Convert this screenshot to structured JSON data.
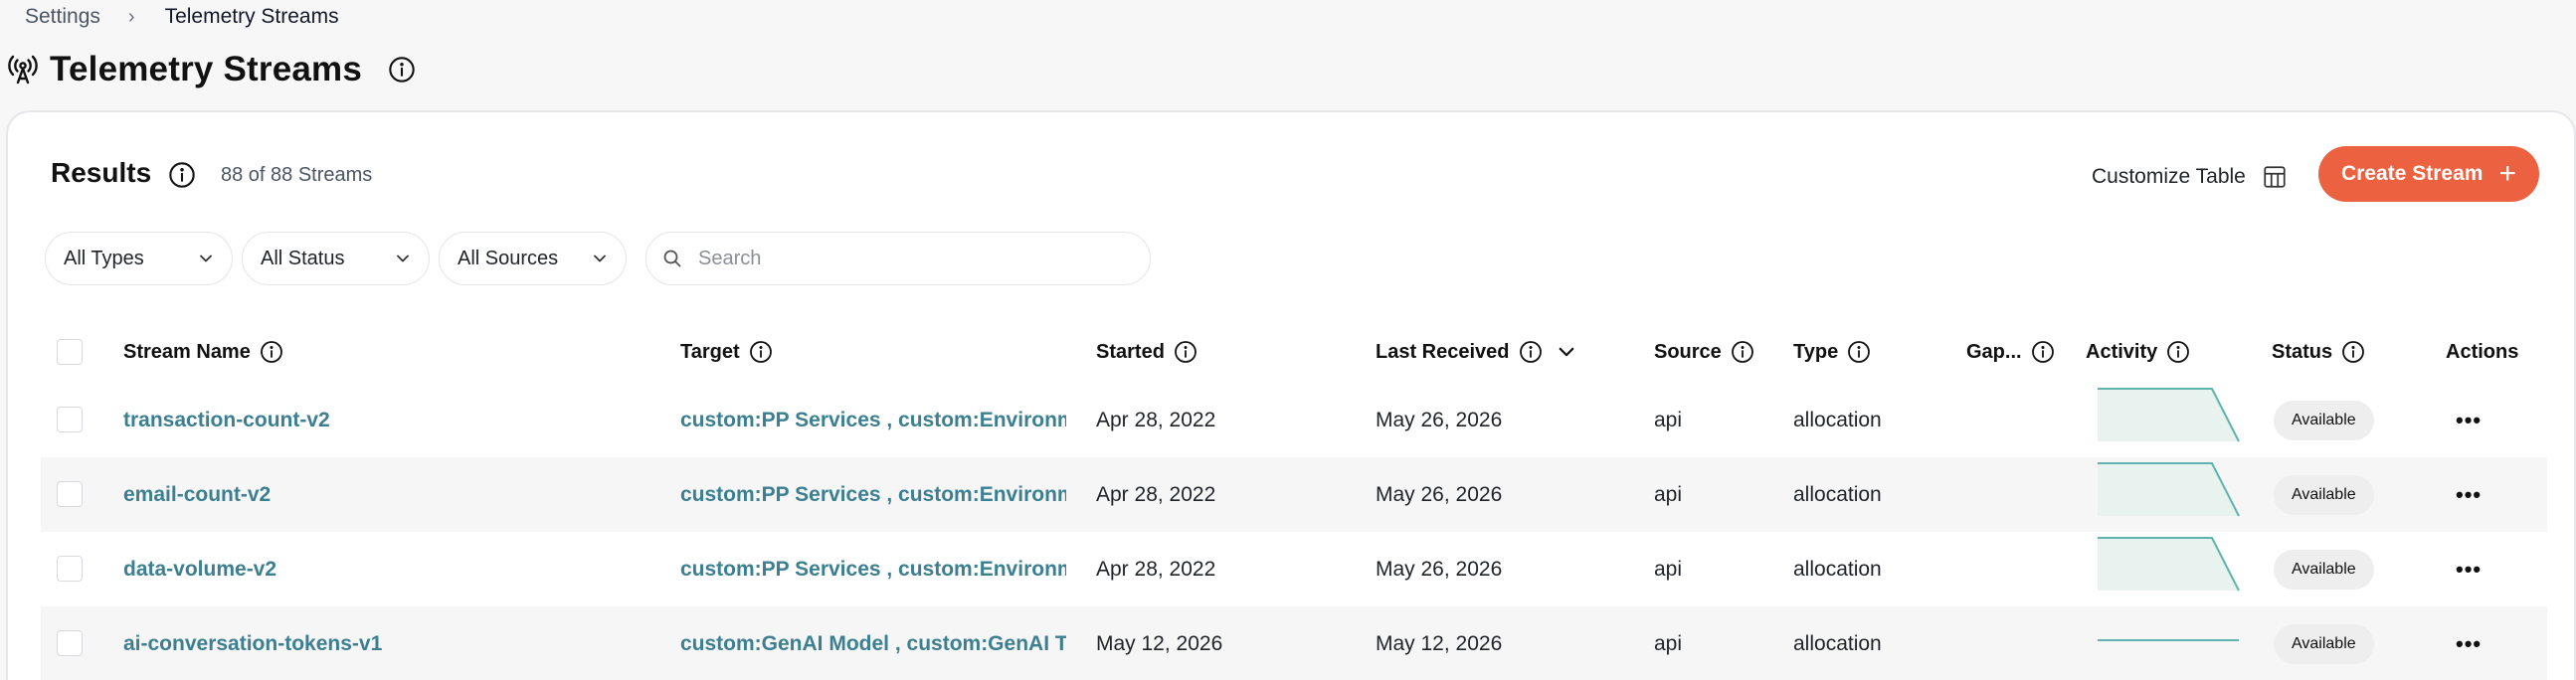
{
  "breadcrumb": {
    "parent": "Settings",
    "separator": "›",
    "current": "Telemetry Streams"
  },
  "page": {
    "title": "Telemetry Streams",
    "title_icon": "antenna-icon"
  },
  "results": {
    "title": "Results",
    "count_text": "88 of 88 Streams"
  },
  "toolbar": {
    "customize_label": "Customize Table",
    "create_label": "Create Stream",
    "create_icon": "+"
  },
  "filters": [
    {
      "label": "All Types"
    },
    {
      "label": "All Status"
    },
    {
      "label": "All Sources"
    }
  ],
  "search": {
    "placeholder": "Search"
  },
  "table": {
    "columns": {
      "name": "Stream Name",
      "target": "Target",
      "started": "Started",
      "last_received": "Last Received",
      "source": "Source",
      "type": "Type",
      "gap": "Gap...",
      "activity": "Activity",
      "status": "Status",
      "actions": "Actions"
    },
    "rows": [
      {
        "name": "transaction-count-v2",
        "target": "custom:PP Services , custom:Environment",
        "started": "Apr 28, 2022",
        "last_received": "May 26, 2026",
        "source": "api",
        "type": "allocation",
        "status": "Available",
        "actions": "•••"
      },
      {
        "name": "email-count-v2",
        "target": "custom:PP Services , custom:Environment",
        "started": "Apr 28, 2022",
        "last_received": "May 26, 2026",
        "source": "api",
        "type": "allocation",
        "status": "Available",
        "actions": "•••"
      },
      {
        "name": "data-volume-v2",
        "target": "custom:PP Services , custom:Environment",
        "started": "Apr 28, 2022",
        "last_received": "May 26, 2026",
        "source": "api",
        "type": "allocation",
        "status": "Available",
        "actions": "•••"
      },
      {
        "name": "ai-conversation-tokens-v1",
        "target": "custom:GenAI Model , custom:GenAI Tokens",
        "started": "May 12, 2026",
        "last_received": "May 12, 2026",
        "source": "api",
        "type": "allocation",
        "status": "Available",
        "actions": "•••"
      }
    ]
  },
  "colors": {
    "accent": "#ec6140",
    "link": "#3b7f91",
    "spark": "#5fb3ad",
    "spark_fill": "#e8f2ef"
  }
}
